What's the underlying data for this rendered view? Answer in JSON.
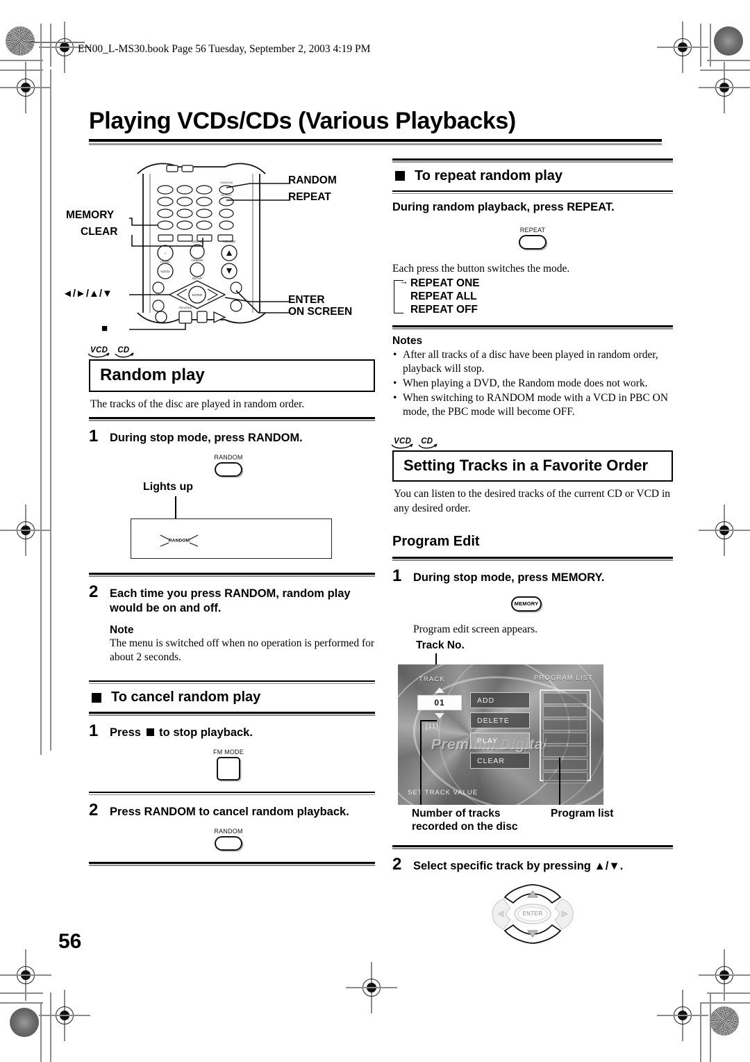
{
  "print_marks": {
    "file_header": "EN00_L-MS30.book  Page 56  Tuesday, September 2, 2003  4:19 PM"
  },
  "page": {
    "title": "Playing VCDs/CDs (Various Playbacks)",
    "number": "56"
  },
  "remote_figure": {
    "name": "remote-control-illustration",
    "callouts": {
      "random": "RANDOM",
      "repeat": "REPEAT",
      "memory": "MEMORY",
      "clear": "CLEAR",
      "cursor": "◄/►/▲/▼",
      "enter": "ENTER",
      "on_screen": "ON SCREEN",
      "stop": "■"
    }
  },
  "left_column": {
    "disc_icons": [
      "VCD",
      "CD"
    ],
    "section_heading": "Random play",
    "intro": "The tracks of the disc are played in random order.",
    "step1": {
      "num": "1",
      "text": "During stop mode, press RANDOM.",
      "button_label": "RANDOM"
    },
    "lights_up": {
      "label": "Lights up",
      "indicator": "RANDOM"
    },
    "step2": {
      "num": "2",
      "text": "Each time you press RANDOM, random play would be on and off."
    },
    "note": {
      "title": "Note",
      "text": "The menu is switched off when no operation is performed for about 2 seconds."
    },
    "cancel_heading": "To cancel random play",
    "cancel_step1": {
      "num": "1",
      "text_before": "Press",
      "text_after": "to stop playback.",
      "button_label": "FM MODE"
    },
    "cancel_step2": {
      "num": "2",
      "text": "Press RANDOM to cancel random playback.",
      "button_label": "RANDOM"
    }
  },
  "right_column": {
    "repeat_heading": "To repeat random play",
    "repeat_instruction": "During random playback, press REPEAT.",
    "repeat_button_label": "REPEAT",
    "repeat_mode_intro": "Each press the button switches the mode.",
    "repeat_modes": [
      "REPEAT ONE",
      "REPEAT ALL",
      "REPEAT OFF"
    ],
    "notes_title": "Notes",
    "notes": [
      "After all tracks of a disc have been played in random order, playback will stop.",
      "When playing a DVD, the Random mode does not work.",
      "When switching to RANDOM mode with a VCD in PBC ON mode, the PBC mode will become OFF."
    ],
    "disc_icons": [
      "VCD",
      "CD"
    ],
    "section_heading": "Setting Tracks in a Favorite Order",
    "intro": "You can listen to the desired tracks of the current CD or VCD in any desired order.",
    "program_edit_heading": "Program Edit",
    "step1": {
      "num": "1",
      "text": "During stop mode, press MEMORY.",
      "button_label": "MEMORY",
      "after_text": "Program edit screen appears."
    },
    "tv_screen": {
      "caption_top": "Track No.",
      "caption_bottom_left": "Number of tracks recorded on the disc",
      "caption_bottom_right": "Program list",
      "track_label": "TRACK",
      "track_value": "01",
      "track_count": "[11]",
      "program_list_label": "PROGRAM LIST",
      "menu_items": [
        "ADD",
        "DELETE",
        "PLAY",
        "CLEAR"
      ],
      "selected_menu_item": "PLAY",
      "status_text": "SET TRACK VALUE",
      "watermark": "Premium Digital",
      "program_rows": 7
    },
    "step2": {
      "num": "2",
      "text": "Select specific track by pressing ▲/▼.",
      "dpad_center_label": "ENTER"
    }
  }
}
